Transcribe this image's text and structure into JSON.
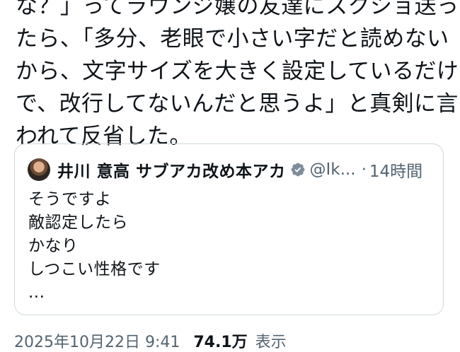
{
  "tweet": {
    "lines": [
      "な？」ってラウンジ嬢の友達にスクショ送っ",
      "たら、「多分、老眼で小さい字だと読めない",
      "から、文字サイズを大きく設定しているだけ",
      "で、改行してないんだと思うよ」と真剣に言",
      "われて反省した。"
    ]
  },
  "quote": {
    "author_name": "井川 意高 サブアカ改め本アカ",
    "handle": "@Ik...",
    "separator": "·",
    "time": "14時間",
    "verified_icon": "verified-badge-icon",
    "verified_color": "#7e8c9a",
    "lines": [
      "そうですよ",
      "敵認定したら",
      "かなり",
      "しつこい性格です",
      "..."
    ]
  },
  "meta": {
    "date_text": "2025年10月22日 9:41",
    "views_count": "74.1万",
    "views_label": "表示"
  }
}
